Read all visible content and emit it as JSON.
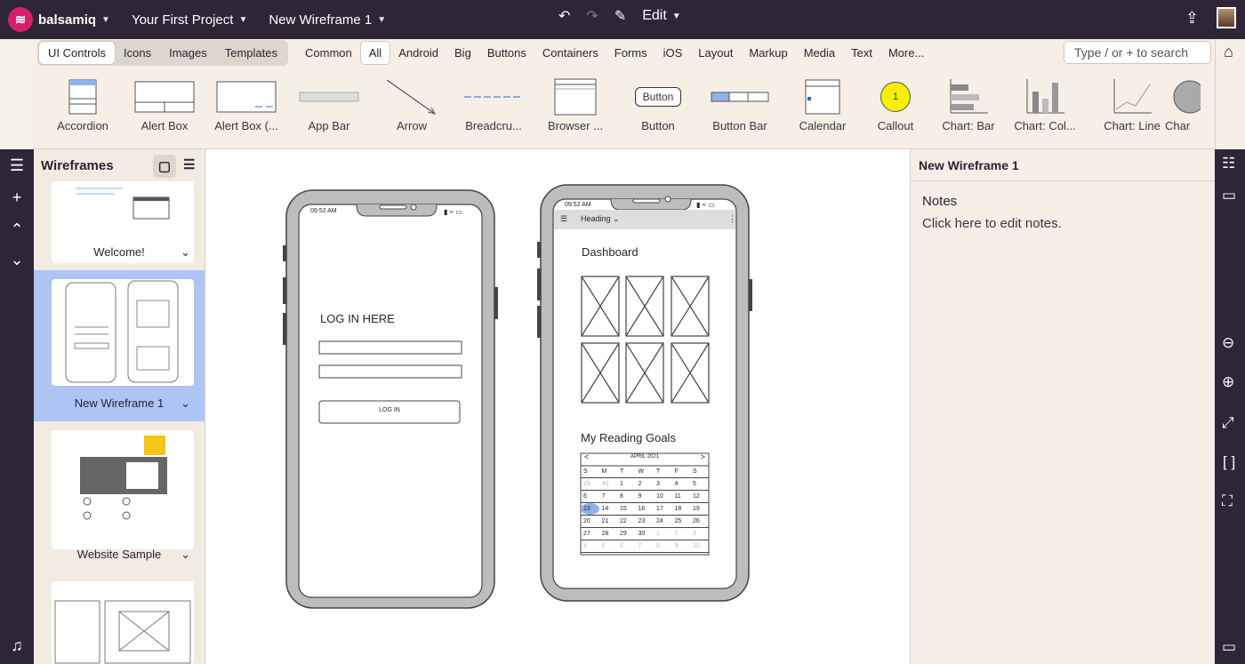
{
  "topbar": {
    "brand": "balsamiq",
    "project": "Your First Project",
    "wireframe": "New Wireframe 1",
    "edit": "Edit"
  },
  "library": {
    "tabs": [
      "UI Controls",
      "Icons",
      "Images",
      "Templates"
    ],
    "active_tab": "UI Controls",
    "categories": [
      "Common",
      "All",
      "Android",
      "Big",
      "Buttons",
      "Containers",
      "Forms",
      "iOS",
      "Layout",
      "Markup",
      "Media",
      "Text",
      "More..."
    ],
    "active_category": "All",
    "search_placeholder": "Type / or + to search",
    "items": [
      "Accordion",
      "Alert Box",
      "Alert Box (...",
      "App Bar",
      "Arrow",
      "Breadcru...",
      "Browser ...",
      "Button",
      "Button Bar",
      "Calendar",
      "Callout",
      "Chart: Bar",
      "Chart: Col...",
      "Chart: Line",
      "Char"
    ]
  },
  "wireframes_panel": {
    "title": "Wireframes",
    "items": [
      "Welcome!",
      "New Wireframe 1",
      "Website Sample"
    ]
  },
  "canvas": {
    "phone1": {
      "time": "09:52 AM",
      "heading": "LOG IN HERE",
      "button": "LOG IN"
    },
    "phone2": {
      "time": "09:52 AM",
      "nav_heading": "Heading",
      "dashboard": "Dashboard",
      "reading_goals": "My Reading Goals",
      "calendar": {
        "month": "APRIL 2021",
        "days": [
          "S",
          "M",
          "T",
          "W",
          "T",
          "F",
          "S"
        ],
        "rows": [
          [
            "29",
            "30",
            "1",
            "2",
            "3",
            "4",
            "5"
          ],
          [
            "6",
            "7",
            "8",
            "9",
            "10",
            "11",
            "12"
          ],
          [
            "13",
            "14",
            "15",
            "16",
            "17",
            "18",
            "19"
          ],
          [
            "20",
            "21",
            "22",
            "23",
            "24",
            "25",
            "26"
          ],
          [
            "27",
            "28",
            "29",
            "30",
            "1",
            "2",
            "3"
          ],
          [
            "4",
            "5",
            "6",
            "7",
            "8",
            "9",
            "10"
          ]
        ]
      }
    }
  },
  "right_panel": {
    "title": "New Wireframe 1",
    "notes_label": "Notes",
    "notes_placeholder": "Click here to edit notes."
  }
}
